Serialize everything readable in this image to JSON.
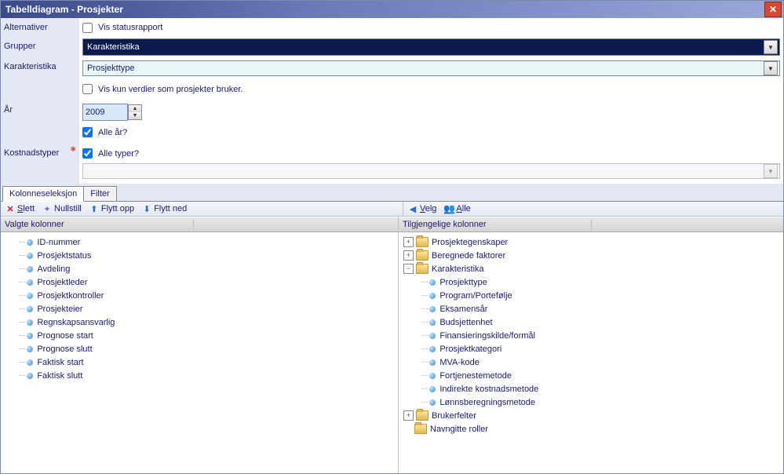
{
  "title": "Tabelldiagram - Prosjekter",
  "form": {
    "alternatives_label": "Alternativer",
    "statusreport_label": "Vis statusrapport",
    "groups_label": "Grupper",
    "groups_value": "Karakteristika",
    "char_label": "Karakteristika",
    "char_value": "Prosjekttype",
    "only_used_label": "Vis kun verdier som prosjekter bruker.",
    "year_label": "År",
    "year_value": "2009",
    "all_years_label": "Alle år?",
    "costtypes_label": "Kostnadstyper",
    "all_types_label": "Alle typer?"
  },
  "tabs": {
    "col_sel": "Kolonneseleksjon",
    "filter": "Filter"
  },
  "toolbar": {
    "delete": "Slett",
    "reset": "Nullstill",
    "move_up": "Flytt opp",
    "move_down": "Flytt ned",
    "select": "Velg",
    "all": "Alle"
  },
  "headers": {
    "selected": "Valgte kolonner",
    "available": "Tilgjengelige kolonner"
  },
  "selected_columns": [
    "ID-nummer",
    "Prosjektstatus",
    "Avdeling",
    "Prosjektleder",
    "Prosjektkontroller",
    "Prosjekteier",
    "Regnskapsansvarlig",
    "Prognose start",
    "Prognose slutt",
    "Faktisk start",
    "Faktisk slutt"
  ],
  "available_tree": {
    "proj_props": "Prosjektegenskaper",
    "calc_factors": "Beregnede faktorer",
    "karakteristika": "Karakteristika",
    "k_children": [
      "Prosjekttype",
      "Program/Portefølje",
      "Eksamensår",
      "Budsjettenhet",
      "Finansieringskilde/formål",
      "Prosjektkategori",
      "MVA-kode",
      "Fortjenestemetode",
      "Indirekte kostnadsmetode",
      "Lønnsberegningsmetode"
    ],
    "user_fields": "Brukerfelter",
    "named_roles": "Navngitte roller"
  }
}
